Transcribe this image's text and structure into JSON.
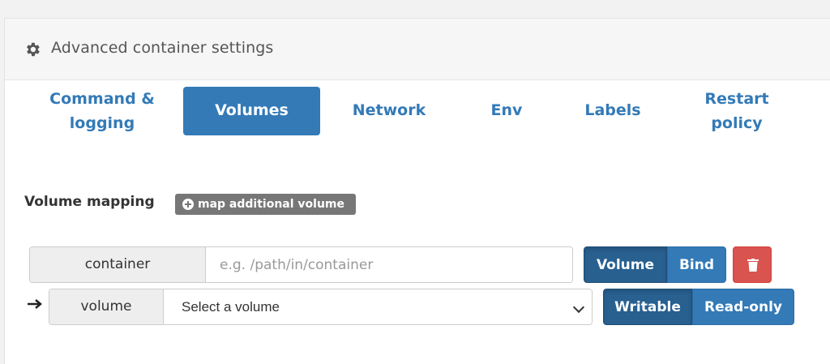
{
  "panel": {
    "title": "Advanced container settings",
    "icon": "gear-icon"
  },
  "tabs": [
    {
      "label_line1": "Command &",
      "label_line2": "logging",
      "active": false
    },
    {
      "label_line1": "Volumes",
      "label_line2": "",
      "active": true
    },
    {
      "label_line1": "Network",
      "label_line2": "",
      "active": false
    },
    {
      "label_line1": "Env",
      "label_line2": "",
      "active": false
    },
    {
      "label_line1": "Labels",
      "label_line2": "",
      "active": false
    },
    {
      "label_line1": "Restart",
      "label_line2": "policy",
      "active": false
    }
  ],
  "volume_mapping": {
    "label": "Volume mapping",
    "add_button": "map additional volume",
    "container_addon": "container",
    "container_placeholder": "e.g. /path/in/container",
    "container_value": "",
    "type_options": [
      "Volume",
      "Bind"
    ],
    "type_selected": "Volume",
    "volume_addon": "volume",
    "volume_select_value": "Select a volume",
    "access_options": [
      "Writable",
      "Read-only"
    ],
    "access_selected": "Writable"
  },
  "colors": {
    "primary": "#337ab7",
    "primary_active": "#286090",
    "danger": "#d9534f",
    "badge": "#777777"
  }
}
